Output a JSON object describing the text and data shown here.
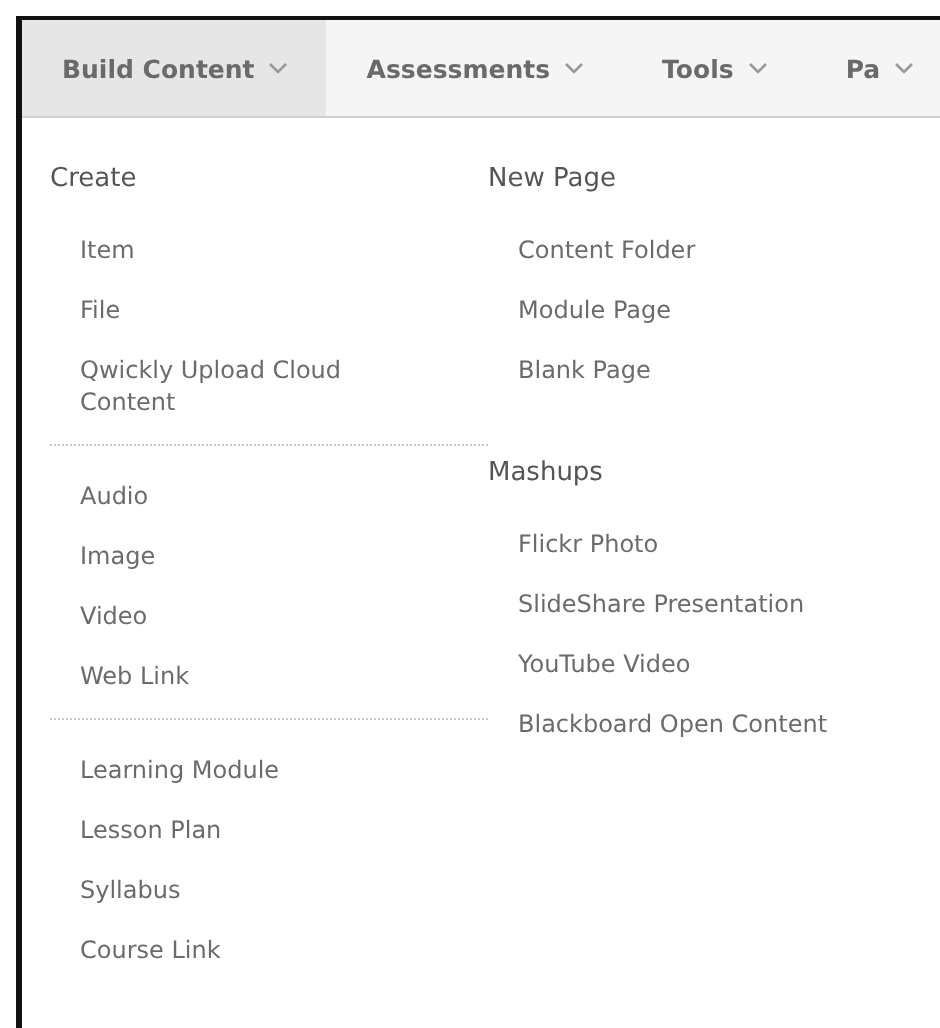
{
  "tabs": [
    {
      "label": "Build Content",
      "selected": true
    },
    {
      "label": "Assessments",
      "selected": false
    },
    {
      "label": "Tools",
      "selected": false
    },
    {
      "label": "Pa",
      "selected": false
    }
  ],
  "menu": {
    "columns": [
      {
        "divided": true,
        "groups": [
          {
            "heading": "Create",
            "items": [
              "Item",
              "File",
              "Qwickly Upload Cloud Content"
            ]
          },
          {
            "items": [
              "Audio",
              "Image",
              "Video",
              "Web Link"
            ]
          },
          {
            "items": [
              "Learning Module",
              "Lesson Plan",
              "Syllabus",
              "Course Link"
            ]
          }
        ]
      },
      {
        "divided": false,
        "groups": [
          {
            "heading": "New Page",
            "items": [
              "Content Folder",
              "Module Page",
              "Blank Page"
            ]
          },
          {
            "heading": "Mashups",
            "items": [
              "Flickr Photo",
              "SlideShare Presentation",
              "YouTube Video",
              "Blackboard Open Content"
            ]
          }
        ]
      }
    ]
  }
}
